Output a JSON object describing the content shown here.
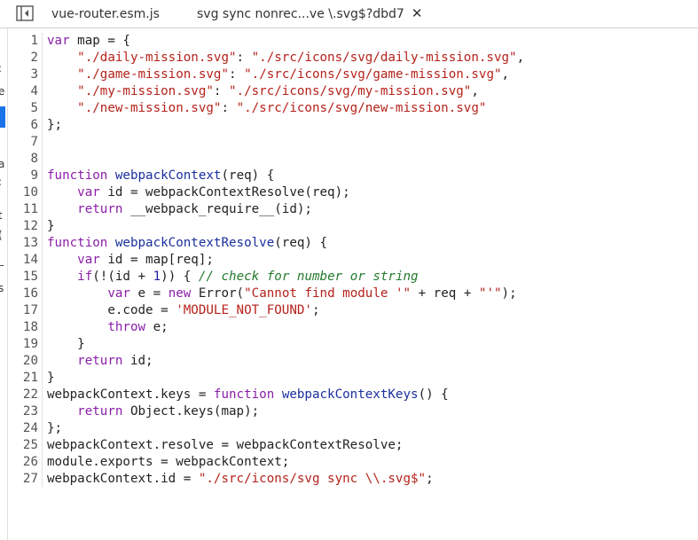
{
  "tabs": [
    {
      "label": "vue-router.esm.js"
    },
    {
      "label": "svg sync nonrec...ve \\.svg$?dbd7",
      "close": "✕"
    }
  ],
  "left_panel_fragments": [
    ":",
    "e",
    "a",
    ":",
    "t",
    "(",
    "_",
    "s"
  ],
  "colors": {
    "keyword": "#8a1fa8",
    "function": "#1a2f9e",
    "string": "#b5221b",
    "comment": "#247a2e",
    "selection": "#1a73e8"
  },
  "code": [
    {
      "n": "1",
      "tokens": [
        {
          "t": "var",
          "c": "kw"
        },
        {
          "t": " map = {",
          "c": "txt"
        }
      ]
    },
    {
      "n": "2",
      "tokens": [
        {
          "t": "    ",
          "c": "txt"
        },
        {
          "t": "\"./daily-mission.svg\"",
          "c": "str"
        },
        {
          "t": ": ",
          "c": "txt"
        },
        {
          "t": "\"./src/icons/svg/daily-mission.svg\"",
          "c": "str"
        },
        {
          "t": ",",
          "c": "txt"
        }
      ]
    },
    {
      "n": "3",
      "tokens": [
        {
          "t": "    ",
          "c": "txt"
        },
        {
          "t": "\"./game-mission.svg\"",
          "c": "str"
        },
        {
          "t": ": ",
          "c": "txt"
        },
        {
          "t": "\"./src/icons/svg/game-mission.svg\"",
          "c": "str"
        },
        {
          "t": ",",
          "c": "txt"
        }
      ]
    },
    {
      "n": "4",
      "tokens": [
        {
          "t": "    ",
          "c": "txt"
        },
        {
          "t": "\"./my-mission.svg\"",
          "c": "str"
        },
        {
          "t": ": ",
          "c": "txt"
        },
        {
          "t": "\"./src/icons/svg/my-mission.svg\"",
          "c": "str"
        },
        {
          "t": ",",
          "c": "txt"
        }
      ]
    },
    {
      "n": "5",
      "tokens": [
        {
          "t": "    ",
          "c": "txt"
        },
        {
          "t": "\"./new-mission.svg\"",
          "c": "str"
        },
        {
          "t": ": ",
          "c": "txt"
        },
        {
          "t": "\"./src/icons/svg/new-mission.svg\"",
          "c": "str"
        }
      ]
    },
    {
      "n": "6",
      "tokens": [
        {
          "t": "};",
          "c": "txt"
        }
      ]
    },
    {
      "n": "7",
      "tokens": []
    },
    {
      "n": "8",
      "tokens": []
    },
    {
      "n": "9",
      "tokens": [
        {
          "t": "function",
          "c": "kw"
        },
        {
          "t": " ",
          "c": "txt"
        },
        {
          "t": "webpackContext",
          "c": "fn"
        },
        {
          "t": "(req) {",
          "c": "txt"
        }
      ]
    },
    {
      "n": "10",
      "tokens": [
        {
          "t": "    ",
          "c": "txt"
        },
        {
          "t": "var",
          "c": "kw"
        },
        {
          "t": " id = webpackContextResolve(req);",
          "c": "txt"
        }
      ]
    },
    {
      "n": "11",
      "tokens": [
        {
          "t": "    ",
          "c": "txt"
        },
        {
          "t": "return",
          "c": "kw"
        },
        {
          "t": " __webpack_require__(id);",
          "c": "txt"
        }
      ]
    },
    {
      "n": "12",
      "tokens": [
        {
          "t": "}",
          "c": "txt"
        }
      ]
    },
    {
      "n": "13",
      "tokens": [
        {
          "t": "function",
          "c": "kw"
        },
        {
          "t": " ",
          "c": "txt"
        },
        {
          "t": "webpackContextResolve",
          "c": "fn"
        },
        {
          "t": "(req) {",
          "c": "txt"
        }
      ]
    },
    {
      "n": "14",
      "tokens": [
        {
          "t": "    ",
          "c": "txt"
        },
        {
          "t": "var",
          "c": "kw"
        },
        {
          "t": " id = map[req];",
          "c": "txt"
        }
      ]
    },
    {
      "n": "15",
      "tokens": [
        {
          "t": "    ",
          "c": "txt"
        },
        {
          "t": "if",
          "c": "kw"
        },
        {
          "t": "(!(id + ",
          "c": "txt"
        },
        {
          "t": "1",
          "c": "num"
        },
        {
          "t": ")) { ",
          "c": "txt"
        },
        {
          "t": "// check for number or string",
          "c": "cm"
        }
      ]
    },
    {
      "n": "16",
      "tokens": [
        {
          "t": "        ",
          "c": "txt"
        },
        {
          "t": "var",
          "c": "kw"
        },
        {
          "t": " e = ",
          "c": "txt"
        },
        {
          "t": "new",
          "c": "kw"
        },
        {
          "t": " Error(",
          "c": "txt"
        },
        {
          "t": "\"Cannot find module '\"",
          "c": "str"
        },
        {
          "t": " + req + ",
          "c": "txt"
        },
        {
          "t": "\"'\"",
          "c": "str"
        },
        {
          "t": ");",
          "c": "txt"
        }
      ]
    },
    {
      "n": "17",
      "tokens": [
        {
          "t": "        e.code = ",
          "c": "txt"
        },
        {
          "t": "'MODULE_NOT_FOUND'",
          "c": "str"
        },
        {
          "t": ";",
          "c": "txt"
        }
      ]
    },
    {
      "n": "18",
      "tokens": [
        {
          "t": "        ",
          "c": "txt"
        },
        {
          "t": "throw",
          "c": "kw"
        },
        {
          "t": " e;",
          "c": "txt"
        }
      ]
    },
    {
      "n": "19",
      "tokens": [
        {
          "t": "    }",
          "c": "txt"
        }
      ]
    },
    {
      "n": "20",
      "tokens": [
        {
          "t": "    ",
          "c": "txt"
        },
        {
          "t": "return",
          "c": "kw"
        },
        {
          "t": " id;",
          "c": "txt"
        }
      ]
    },
    {
      "n": "21",
      "tokens": [
        {
          "t": "}",
          "c": "txt"
        }
      ]
    },
    {
      "n": "22",
      "tokens": [
        {
          "t": "webpackContext.keys = ",
          "c": "txt"
        },
        {
          "t": "function",
          "c": "kw"
        },
        {
          "t": " ",
          "c": "txt"
        },
        {
          "t": "webpackContextKeys",
          "c": "fn"
        },
        {
          "t": "() {",
          "c": "txt"
        }
      ]
    },
    {
      "n": "23",
      "tokens": [
        {
          "t": "    ",
          "c": "txt"
        },
        {
          "t": "return",
          "c": "kw"
        },
        {
          "t": " Object.keys(map);",
          "c": "txt"
        }
      ]
    },
    {
      "n": "24",
      "tokens": [
        {
          "t": "};",
          "c": "txt"
        }
      ]
    },
    {
      "n": "25",
      "tokens": [
        {
          "t": "webpackContext.resolve = webpackContextResolve;",
          "c": "txt"
        }
      ]
    },
    {
      "n": "26",
      "tokens": [
        {
          "t": "module.exports = webpackContext;",
          "c": "txt"
        }
      ]
    },
    {
      "n": "27",
      "tokens": [
        {
          "t": "webpackContext.id = ",
          "c": "txt"
        },
        {
          "t": "\"./src/icons/svg sync \\\\.svg$\"",
          "c": "str"
        },
        {
          "t": ";",
          "c": "txt"
        }
      ]
    }
  ]
}
